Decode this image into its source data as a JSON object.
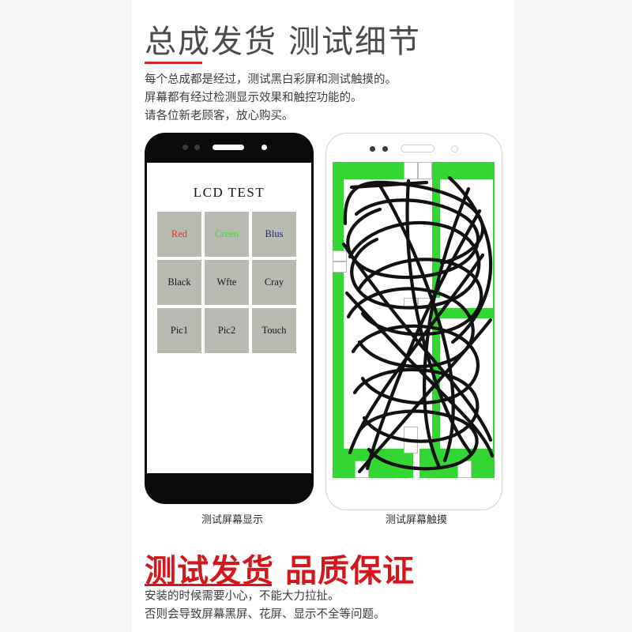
{
  "header": {
    "title_part1": "总成发货",
    "title_part2": "测试细节",
    "intro_lines": [
      "每个总成都是经过，测试黑白彩屏和测试触摸的。",
      "屏幕都有经过检测显示效果和触控功能的。",
      "请各位新老顾客，放心购买。"
    ]
  },
  "left_phone": {
    "lcd_title": "LCD  TEST",
    "tiles": [
      {
        "label": "Red",
        "color": "#e53327"
      },
      {
        "label": "Creen",
        "color": "#2ee02e"
      },
      {
        "label": "Blus",
        "color": "#1f1f8f"
      },
      {
        "label": "Black",
        "color": "#16161c"
      },
      {
        "label": "Wfte",
        "color": "#16161c"
      },
      {
        "label": "Cray",
        "color": "#16161c"
      },
      {
        "label": "Pic1",
        "color": "#16161c"
      },
      {
        "label": "Pic2",
        "color": "#16161c"
      },
      {
        "label": "Touch",
        "color": "#16161c"
      }
    ],
    "tile_bg": "#b8bbb2",
    "caption": "测试屏幕显示"
  },
  "right_phone": {
    "screen_color": "#33d633",
    "caption": "测试屏幕触摸"
  },
  "footer": {
    "title_part1": "测试发货",
    "title_part2": "品质保证",
    "lines": [
      "安装的时候需要小心，不能大力拉扯。",
      "否则会导致屏幕黑屏、花屏、显示不全等问题。"
    ],
    "accent_color": "#d6161b"
  }
}
